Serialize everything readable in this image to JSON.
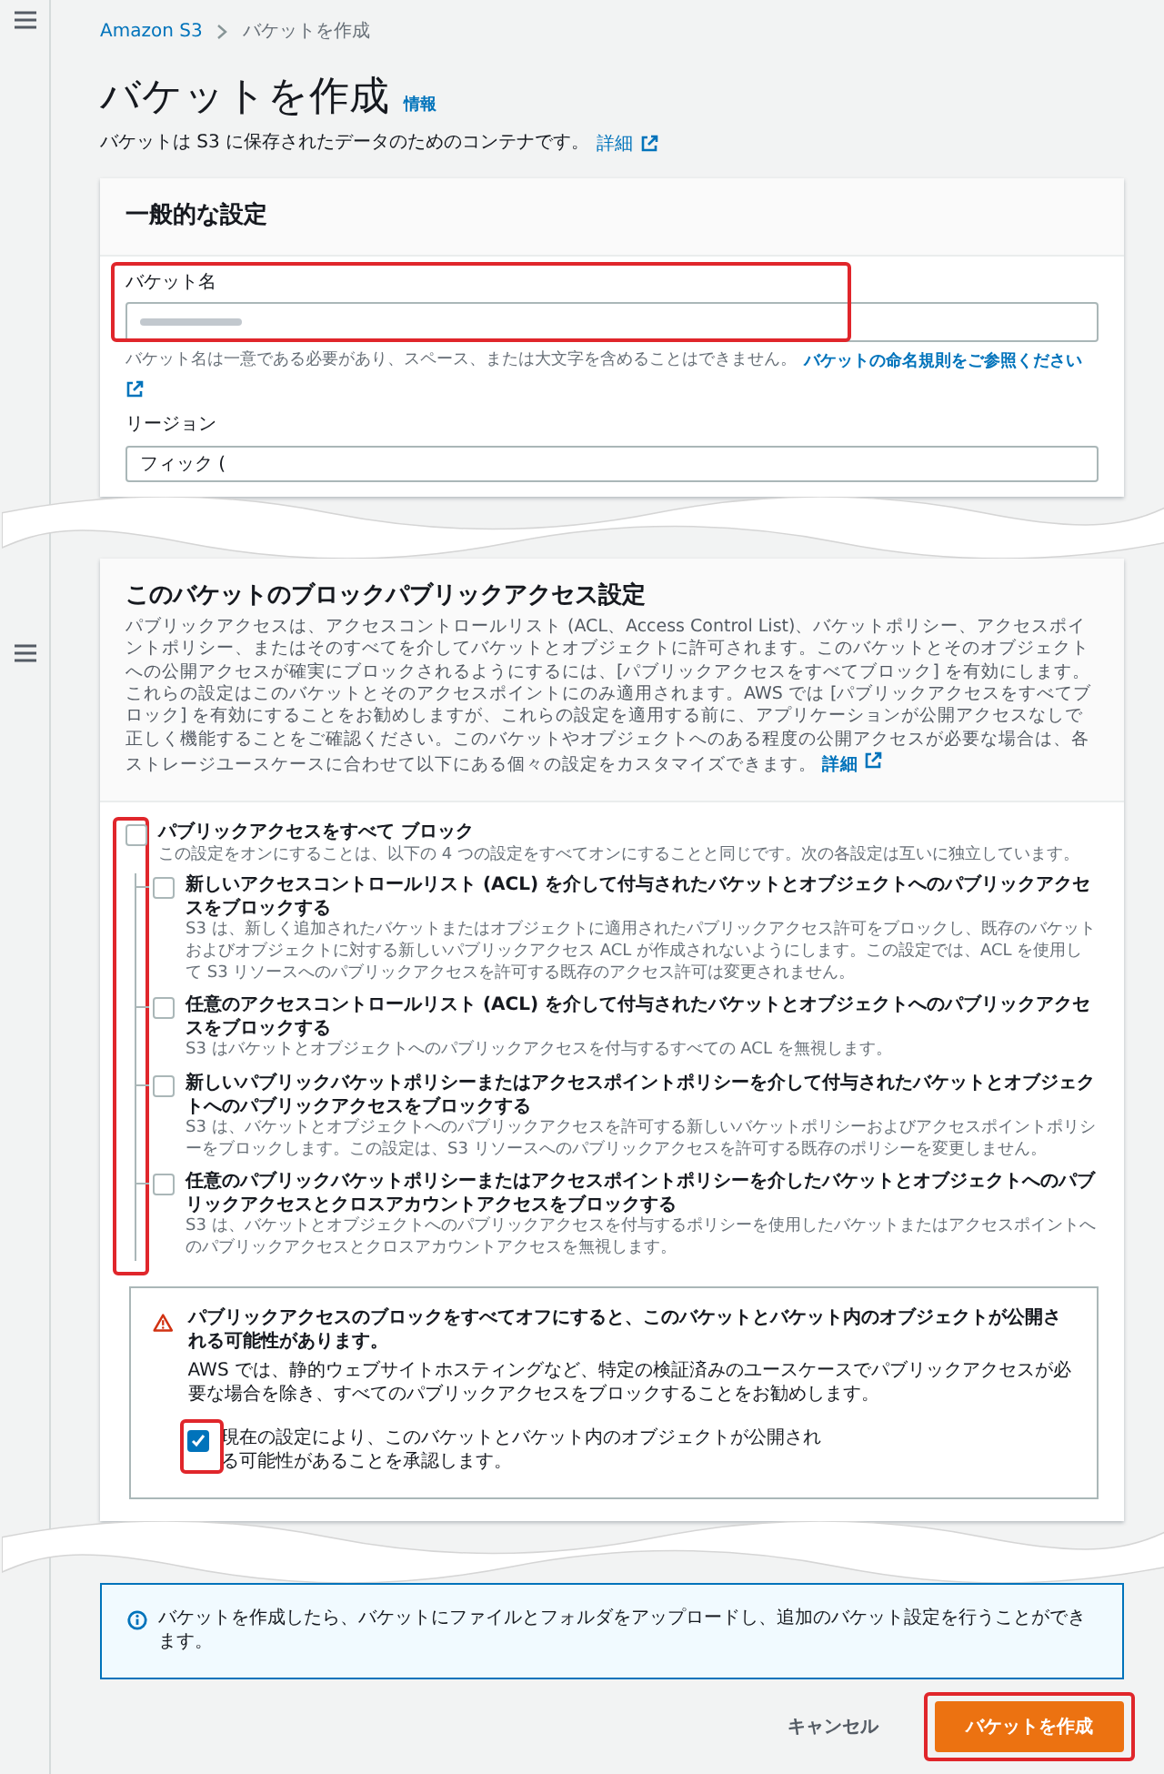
{
  "breadcrumb": [
    {
      "label": "Amazon S3",
      "link": true
    },
    {
      "label": "バケットを作成",
      "link": false
    }
  ],
  "page": {
    "title": "バケットを作成",
    "info_link": "情報",
    "description": "バケットは S3 に保存されたデータのためのコンテナです。",
    "description_link": "詳細"
  },
  "general": {
    "heading": "一般的な設定",
    "bucket_name": {
      "label": "バケット名",
      "hint": "バケット名は一意である必要があり、スペース、または大文字を含めることはできません。",
      "hint_link": "バケットの命名規則をご参照ください"
    },
    "region": {
      "label": "リージョン",
      "value": "フィック ("
    }
  },
  "block_public_access": {
    "heading": "このバケットのブロックパブリックアクセス設定",
    "description": "パブリックアクセスは、アクセスコントロールリスト (ACL、Access Control List)、バケットポリシー、アクセスポイントポリシー、またはそのすべてを介してバケットとオブジェクトに許可されます。このバケットとそのオブジェクトへの公開アクセスが確実にブロックされるようにするには、[パブリックアクセスをすべてブロック] を有効にします。これらの設定はこのバケットとそのアクセスポイントにのみ適用されます。AWS では [パブリックアクセスをすべてブロック] を有効にすることをお勧めしますが、これらの設定を適用する前に、アプリケーションが公開アクセスなしで正しく機能することをご確認ください。このバケットやオブジェクトへのある程度の公開アクセスが必要な場合は、各ストレージユースケースに合わせて以下にある個々の設定をカスタマイズできます。",
    "description_link": "詳細",
    "options": [
      {
        "title": "パブリックアクセスをすべて ブロック",
        "description": "この設定をオンにすることは、以下の 4 つの設定をすべてオンにすることと同じです。次の各設定は互いに独立しています。",
        "checked": false,
        "children": [
          {
            "title": "新しいアクセスコントロールリスト (ACL) を介して付与されたバケットとオブジェクトへのパブリックアクセスをブロックする",
            "description": "S3 は、新しく追加されたバケットまたはオブジェクトに適用されたパブリックアクセス許可をブロックし、既存のバケットおよびオブジェクトに対する新しいパブリックアクセス ACL が作成されないようにします。この設定では、ACL を使用して S3 リソースへのパブリックアクセスを許可する既存のアクセス許可は変更されません。",
            "checked": false
          },
          {
            "title": "任意のアクセスコントロールリスト (ACL) を介して付与されたバケットとオブジェクトへのパブリックアクセスをブロックする",
            "description": "S3 はバケットとオブジェクトへのパブリックアクセスを付与するすべての ACL を無視します。",
            "checked": false
          },
          {
            "title": "新しいパブリックバケットポリシーまたはアクセスポイントポリシーを介して付与されたバケットとオブジェクトへのパブリックアクセスをブロックする",
            "description": "S3 は、バケットとオブジェクトへのパブリックアクセスを許可する新しいバケットポリシーおよびアクセスポイントポリシーをブロックします。この設定は、S3 リソースへのパブリックアクセスを許可する既存のポリシーを変更しません。",
            "checked": false
          },
          {
            "title": "任意のパブリックバケットポリシーまたはアクセスポイントポリシーを介したバケットとオブジェクトへのパブリックアクセスとクロスアカウントアクセスをブロックする",
            "description": "S3 は、バケットとオブジェクトへのパブリックアクセスを付与するポリシーを使用したバケットまたはアクセスポイントへのパブリックアクセスとクロスアカウントアクセスを無視します。",
            "checked": false
          }
        ]
      }
    ],
    "warning": {
      "title": "パブリックアクセスのブロックをすべてオフにすると、このバケットとバケット内のオブジェクトが公開される可能性があります。",
      "text": "AWS では、静的ウェブサイトホスティングなど、特定の検証済みのユースケースでパブリックアクセスが必要な場合を除き、すべてのパブリックアクセスをブロックすることをお勧めします。",
      "acknowledge": {
        "label": "現在の設定により、このバケットとバケット内のオブジェクトが公開される可能性があることを承認します。",
        "checked": true
      }
    }
  },
  "info_alert": {
    "text": "バケットを作成したら、バケットにファイルとフォルダをアップロードし、追加のバケット設定を行うことができます。"
  },
  "actions": [
    {
      "label": "キャンセル",
      "kind": "link"
    },
    {
      "label": "バケットを作成",
      "kind": "primary"
    }
  ]
}
